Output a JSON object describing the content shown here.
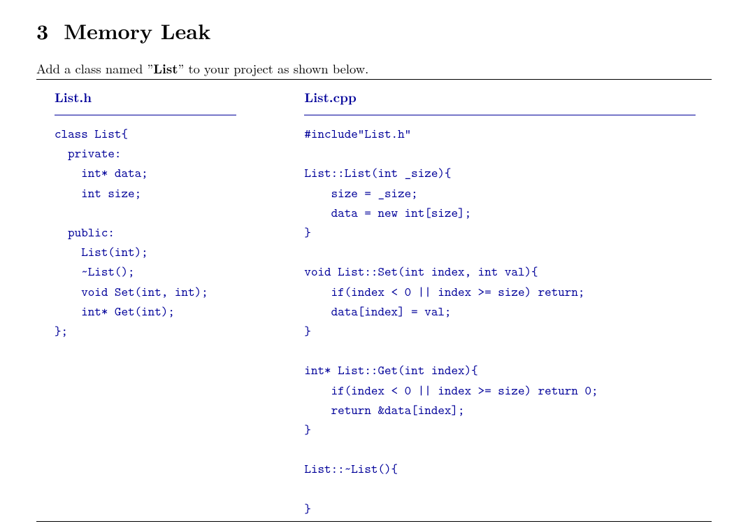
{
  "section": {
    "number": "3",
    "title": "Memory Leak"
  },
  "intro": {
    "prefix": "Add a class named ”",
    "bold": "List",
    "suffix": "” to your project as shown below."
  },
  "file_h": {
    "title": "List.h",
    "code": "class List{\n  private:\n    int* data;\n    int size;\n\n  public:\n    List(int);\n    ~List();\n    void Set(int, int);\n    int* Get(int);\n};"
  },
  "file_cpp": {
    "title": "List.cpp",
    "code": "#include\"List.h\"\n\nList::List(int _size){\n    size = _size;\n    data = new int[size];\n}\n\nvoid List::Set(int index, int val){\n    if(index < 0 || index >= size) return;\n    data[index] = val;\n}\n\nint* List::Get(int index){\n    if(index < 0 || index >= size) return 0;\n    return &data[index];\n}\n\nList::~List(){\n\n}"
  }
}
